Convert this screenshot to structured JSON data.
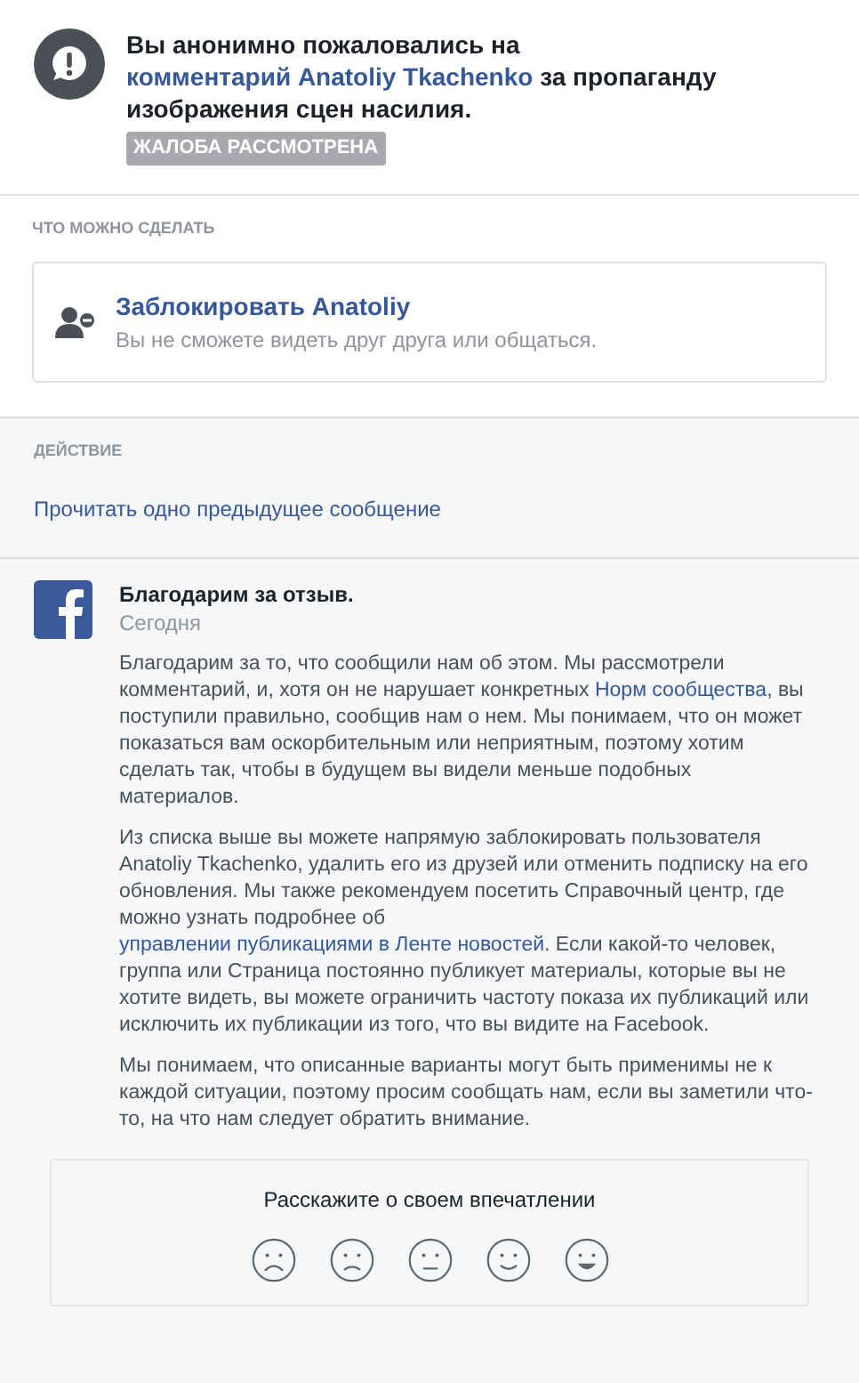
{
  "report": {
    "headline": [
      {
        "kind": "text",
        "text": "Вы анонимно пожаловались на "
      },
      {
        "kind": "link",
        "text": "комментарий Anatoliy Tkachenko"
      },
      {
        "kind": "text",
        "text": " за пропаганду изображения сцен насилия."
      }
    ],
    "status_badge": "ЖАЛОБА РАССМОТРЕНА"
  },
  "options": {
    "heading": "ЧТО МОЖНО СДЕЛАТЬ",
    "block": {
      "title": "Заблокировать Anatoliy",
      "description": "Вы не сможете видеть друг друга или общаться."
    }
  },
  "action": {
    "heading": "ДЕЙСТВИЕ",
    "link": "Прочитать одно предыдущее сообщение"
  },
  "message": {
    "title": "Благодарим за отзыв.",
    "time": "Сегодня",
    "paragraphs": [
      [
        {
          "kind": "text",
          "text": "Благодарим за то, что сообщили нам об этом. Мы рассмотрели комментарий, и, хотя он не нарушает конкретных "
        },
        {
          "kind": "link",
          "text": "Норм сообщества"
        },
        {
          "kind": "text",
          "text": ", вы поступили правильно, сообщив нам о нем. Мы понимаем, что он может показаться вам оскорбительным или неприятным, поэтому хотим сделать так, чтобы в будущем вы видели меньше подобных материалов."
        }
      ],
      [
        {
          "kind": "text",
          "text": "Из списка выше вы можете напрямую заблокировать пользователя Anatoliy Tkachenko, удалить его из друзей или отменить подписку на его обновления. Мы также рекомендуем посетить Справочный центр, где можно узнать подробнее об "
        },
        {
          "kind": "link",
          "text": "управлении публикациями в Ленте новостей"
        },
        {
          "kind": "text",
          "text": ". Если какой-то человек, группа или Страница постоянно публикует материалы, которые вы не хотите видеть, вы можете ограничить частоту показа их публикаций или исключить их публикации из того, что вы видите на Facebook."
        }
      ],
      [
        {
          "kind": "text",
          "text": "Мы понимаем, что описанные варианты могут быть применимы не к каждой ситуации, поэтому просим сообщать нам, если вы заметили что-то, на что нам следует обратить внимание."
        }
      ]
    ]
  },
  "feedback": {
    "prompt": "Расскажите о своем впечатлении"
  }
}
